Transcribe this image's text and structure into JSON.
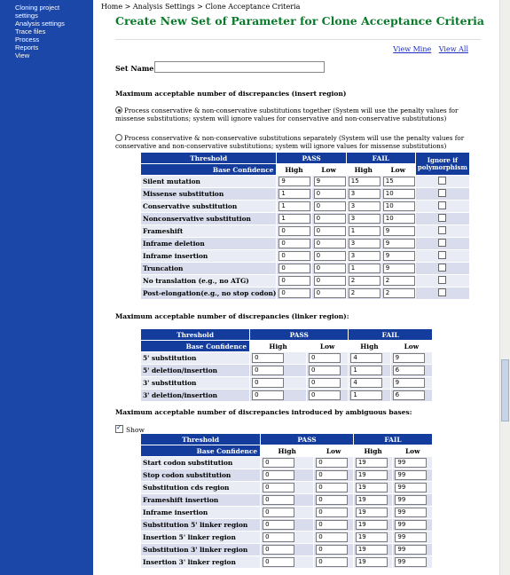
{
  "sidebar": {
    "items": [
      {
        "label": "Cloning project"
      },
      {
        "label": "settings"
      },
      {
        "label": "Analysis settings"
      },
      {
        "label": "Trace files"
      },
      {
        "label": "Process"
      },
      {
        "label": "Reports"
      },
      {
        "label": "View"
      }
    ]
  },
  "breadcrumb": "Home > Analysis Settings > Clone Acceptance Criteria",
  "title": "Create New Set of Parameter for Clone Acceptance Criteria",
  "links": {
    "view_mine": "View Mine",
    "view_all": "View All"
  },
  "set_name": {
    "label": "Set Name",
    "value": ""
  },
  "insert": {
    "heading": "Maximum acceptable number of discrepancies (insert region)",
    "option1": "Process conservative & non-conservative substitutions together (System will use the penalty values for missense substitutions; system will ignore values for conservative and non-conservative substitutions)",
    "option2": "Process conservative & non-conservative substitutions separately (System will use the penalty values for conservative and non-conservative substitutions; system will ignore values for missense substitutions)",
    "h_threshold": "Threshold",
    "h_pass": "PASS",
    "h_fail": "FAIL",
    "h_ignore": "Ignore if polymorphism",
    "h_bc": "Base Confidence",
    "h_high": "High",
    "h_low": "Low",
    "rows": [
      {
        "label": "Silent mutation",
        "pass_high": "9",
        "pass_low": "9",
        "fail_high": "15",
        "fail_low": "15"
      },
      {
        "label": "Missense substitution",
        "pass_high": "1",
        "pass_low": "0",
        "fail_high": "3",
        "fail_low": "10"
      },
      {
        "label": "Conservative substitution",
        "pass_high": "1",
        "pass_low": "0",
        "fail_high": "3",
        "fail_low": "10"
      },
      {
        "label": "Nonconservative substitution",
        "pass_high": "1",
        "pass_low": "0",
        "fail_high": "3",
        "fail_low": "10"
      },
      {
        "label": "Frameshift",
        "pass_high": "0",
        "pass_low": "0",
        "fail_high": "1",
        "fail_low": "9"
      },
      {
        "label": "Inframe deletion",
        "pass_high": "0",
        "pass_low": "0",
        "fail_high": "3",
        "fail_low": "9"
      },
      {
        "label": "Inframe insertion",
        "pass_high": "0",
        "pass_low": "0",
        "fail_high": "3",
        "fail_low": "9"
      },
      {
        "label": "Truncation",
        "pass_high": "0",
        "pass_low": "0",
        "fail_high": "1",
        "fail_low": "9"
      },
      {
        "label": "No translation (e.g., no ATG)",
        "pass_high": "0",
        "pass_low": "0",
        "fail_high": "2",
        "fail_low": "2"
      },
      {
        "label": "Post-elongation(e.g., no stop codon)",
        "pass_high": "0",
        "pass_low": "0",
        "fail_high": "2",
        "fail_low": "2"
      }
    ]
  },
  "linker": {
    "heading": "Maximum acceptable number of discrepancies (linker region):",
    "rows": [
      {
        "label": "5' substitution",
        "pass_high": "0",
        "pass_low": "0",
        "fail_high": "4",
        "fail_low": "9"
      },
      {
        "label": "5' deletion/insertion",
        "pass_high": "0",
        "pass_low": "0",
        "fail_high": "1",
        "fail_low": "6"
      },
      {
        "label": "3' substitution",
        "pass_high": "0",
        "pass_low": "0",
        "fail_high": "4",
        "fail_low": "9"
      },
      {
        "label": "3' deletion/insertion",
        "pass_high": "0",
        "pass_low": "0",
        "fail_high": "1",
        "fail_low": "6"
      }
    ]
  },
  "ambig": {
    "heading": "Maximum acceptable number of discrepancies introduced by ambiguous bases:",
    "show_label": "Show",
    "rows": [
      {
        "label": "Start codon substitution",
        "pass_high": "0",
        "pass_low": "0",
        "fail_high": "19",
        "fail_low": "99"
      },
      {
        "label": "Stop codon substitution",
        "pass_high": "0",
        "pass_low": "0",
        "fail_high": "19",
        "fail_low": "99"
      },
      {
        "label": "Substitution cds region",
        "pass_high": "0",
        "pass_low": "0",
        "fail_high": "19",
        "fail_low": "99"
      },
      {
        "label": "Frameshift insertion",
        "pass_high": "0",
        "pass_low": "0",
        "fail_high": "19",
        "fail_low": "99"
      },
      {
        "label": "Inframe insertion",
        "pass_high": "0",
        "pass_low": "0",
        "fail_high": "19",
        "fail_low": "99"
      },
      {
        "label": "Substitution 5' linker region",
        "pass_high": "0",
        "pass_low": "0",
        "fail_high": "19",
        "fail_low": "99"
      },
      {
        "label": "Insertion 5' linker region",
        "pass_high": "0",
        "pass_low": "0",
        "fail_high": "19",
        "fail_low": "99"
      },
      {
        "label": "Substitution 3' linker region",
        "pass_high": "0",
        "pass_low": "0",
        "fail_high": "19",
        "fail_low": "99"
      },
      {
        "label": "Insertion 3' linker region",
        "pass_high": "0",
        "pass_low": "0",
        "fail_high": "19",
        "fail_low": "99"
      }
    ]
  },
  "colors": {
    "sidebar": "#1a47a8",
    "header": "#143c9c",
    "title": "#0a7a2a",
    "link": "#1e2fbf"
  }
}
